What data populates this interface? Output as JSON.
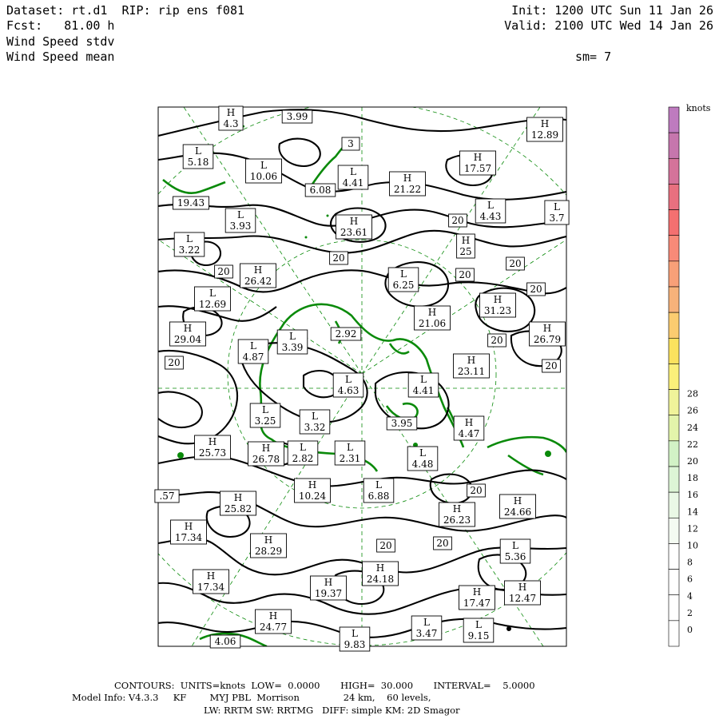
{
  "header": {
    "dataset": "Dataset: rt.d1  RIP: rip ens f081",
    "fcst": "Fcst:   81.00 h",
    "field1": "Wind Speed stdv",
    "field2": "Wind Speed mean",
    "init": "Init: 1200 UTC Sun 11 Jan 26",
    "valid": "Valid: 2100 UTC Wed 14 Jan 26",
    "smooth": "sm= 7"
  },
  "colorbar": {
    "units": "knots",
    "labels": [
      "0",
      "2",
      "4",
      "6",
      "8",
      "10",
      "12",
      "14",
      "16",
      "18",
      "20",
      "22",
      "24",
      "26",
      "28"
    ],
    "colors": [
      "#ffffff",
      "#ffffff",
      "#ffffff",
      "#ffffff",
      "#f4fbf2",
      "#eaf8e6",
      "#ddf5d6",
      "#d2f2c6",
      "#e3f4ab",
      "#f0f39a",
      "#fbf07a",
      "#fbe25e",
      "#fbcc70",
      "#f6b27a",
      "#f8a078",
      "#f88a78",
      "#f47070",
      "#e8707f",
      "#d4739a",
      "#c676ad",
      "#be7bbf"
    ]
  },
  "footer": {
    "line1": "CONTOURS:  UNITS=knots  LOW=  0.0000       HIGH=  30.000       INTERVAL=    5.0000",
    "line2": "Model Info: V4.3.3     KF        MYJ PBL  Morrison               24 km,    60 levels,",
    "line3": "LW: RRTM SW: RRTMG   DIFF: simple KM: 2D Smagor"
  },
  "map_labels": [
    {
      "t": "H",
      "v": "4.3"
    },
    {
      "t": "",
      "v": "3.99"
    },
    {
      "t": "H",
      "v": "12.89"
    },
    {
      "t": "L",
      "v": "5.18"
    },
    {
      "t": "L",
      "v": "10.06"
    },
    {
      "t": "",
      "v": "3"
    },
    {
      "t": "",
      "v": "6.08"
    },
    {
      "t": "L",
      "v": "4.41"
    },
    {
      "t": "H",
      "v": "21.22"
    },
    {
      "t": "H",
      "v": "17.57"
    },
    {
      "t": "",
      "v": "19.43"
    },
    {
      "t": "L",
      "v": "4.43"
    },
    {
      "t": "L",
      "v": "3.7"
    },
    {
      "t": "L",
      "v": "3.93"
    },
    {
      "t": "H",
      "v": "23.61"
    },
    {
      "t": "",
      "v": "20"
    },
    {
      "t": "L",
      "v": "3.22"
    },
    {
      "t": "H",
      "v": "25"
    },
    {
      "t": "",
      "v": "20"
    },
    {
      "t": "",
      "v": "20"
    },
    {
      "t": "",
      "v": "20"
    },
    {
      "t": "H",
      "v": "26.42"
    },
    {
      "t": "L",
      "v": "6.25"
    },
    {
      "t": "",
      "v": "20"
    },
    {
      "t": "",
      "v": "20"
    },
    {
      "t": "L",
      "v": "12.69"
    },
    {
      "t": "H",
      "v": "31.23"
    },
    {
      "t": "H",
      "v": "21.06"
    },
    {
      "t": "H",
      "v": "29.04"
    },
    {
      "t": "L",
      "v": "3.39"
    },
    {
      "t": "",
      "v": "2.92"
    },
    {
      "t": "L",
      "v": "4.87"
    },
    {
      "t": "",
      "v": "20"
    },
    {
      "t": "H",
      "v": "26.79"
    },
    {
      "t": "",
      "v": "20"
    },
    {
      "t": "H",
      "v": "23.11"
    },
    {
      "t": "",
      "v": "20"
    },
    {
      "t": "L",
      "v": "4.63"
    },
    {
      "t": "L",
      "v": "4.41"
    },
    {
      "t": "L",
      "v": "3.25"
    },
    {
      "t": "L",
      "v": "3.32"
    },
    {
      "t": "",
      "v": "3.95"
    },
    {
      "t": "H",
      "v": "4.47"
    },
    {
      "t": "H",
      "v": "25.73"
    },
    {
      "t": "H",
      "v": "26.78"
    },
    {
      "t": "L",
      "v": "2.82"
    },
    {
      "t": "L",
      "v": "2.31"
    },
    {
      "t": "L",
      "v": "4.48"
    },
    {
      "t": "",
      "v": ".57"
    },
    {
      "t": "H",
      "v": "10.24"
    },
    {
      "t": "L",
      "v": "6.88"
    },
    {
      "t": "",
      "v": "20"
    },
    {
      "t": "H",
      "v": "24.66"
    },
    {
      "t": "H",
      "v": "25.82"
    },
    {
      "t": "H",
      "v": "26.23"
    },
    {
      "t": "H",
      "v": "17.34"
    },
    {
      "t": "H",
      "v": "28.29"
    },
    {
      "t": "",
      "v": "20"
    },
    {
      "t": "",
      "v": "20"
    },
    {
      "t": "L",
      "v": "5.36"
    },
    {
      "t": "H",
      "v": "17.34"
    },
    {
      "t": "H",
      "v": "19.37"
    },
    {
      "t": "H",
      "v": "24.18"
    },
    {
      "t": "H",
      "v": "17.47"
    },
    {
      "t": "H",
      "v": "12.47"
    },
    {
      "t": "H",
      "v": "24.77"
    },
    {
      "t": "L",
      "v": "3.47"
    },
    {
      "t": "L",
      "v": "9.15"
    },
    {
      "t": "",
      "v": "4.06"
    },
    {
      "t": "L",
      "v": "9.83"
    }
  ]
}
